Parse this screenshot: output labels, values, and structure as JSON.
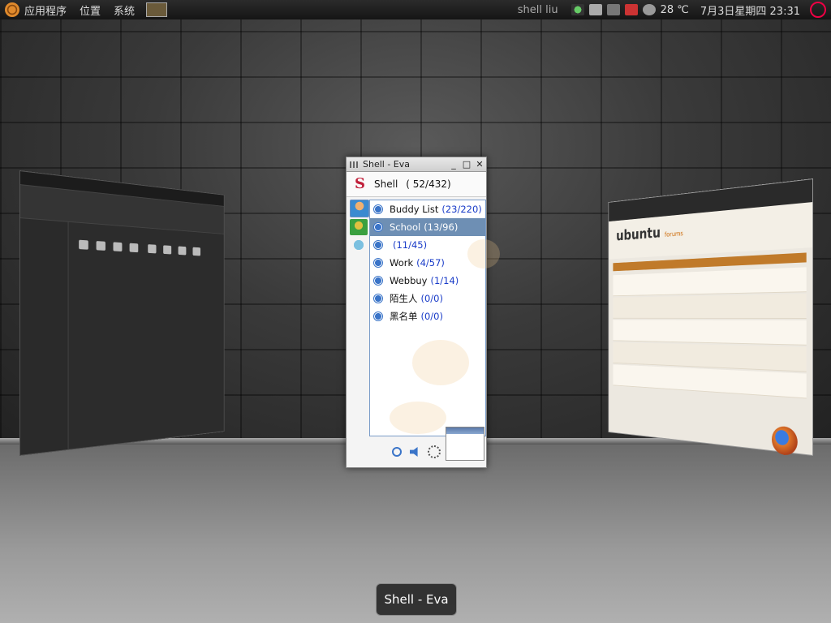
{
  "panel": {
    "menu_apps": "应用程序",
    "menu_places": "位置",
    "menu_system": "系统",
    "user": "shell liu",
    "temperature": "28 ℃",
    "datetime": "7月3日星期四 23:31"
  },
  "eva": {
    "title": "Shell - Eva",
    "username": "Shell",
    "status_count": "( 52/432)",
    "groups": [
      {
        "name": "Buddy List",
        "count": "(23/220)"
      },
      {
        "name": "School",
        "count": "(13/96)"
      },
      {
        "name": "",
        "count": "(11/45)"
      },
      {
        "name": "Work",
        "count": "(4/57)"
      },
      {
        "name": "Webbuy",
        "count": "(1/14)"
      },
      {
        "name": "陌生人",
        "count": "(0/0)"
      },
      {
        "name": "黑名单",
        "count": "(0/0)"
      }
    ],
    "selected_group": "School"
  },
  "switcher_label": "Shell - Eva",
  "right_window": {
    "brand": "ubuntu",
    "brand_sub": "forums"
  },
  "colors": {
    "selection": "#6e8fb4",
    "count_blue": "#1a3cc8",
    "accent_orange": "#e08a2c"
  },
  "icons": [
    "ubuntu-logo-icon",
    "terminal-icon",
    "network-icon",
    "printer-icon",
    "volume-icon",
    "weather-icon",
    "power-icon",
    "search-icon",
    "speaker-icon",
    "gear-icon"
  ]
}
